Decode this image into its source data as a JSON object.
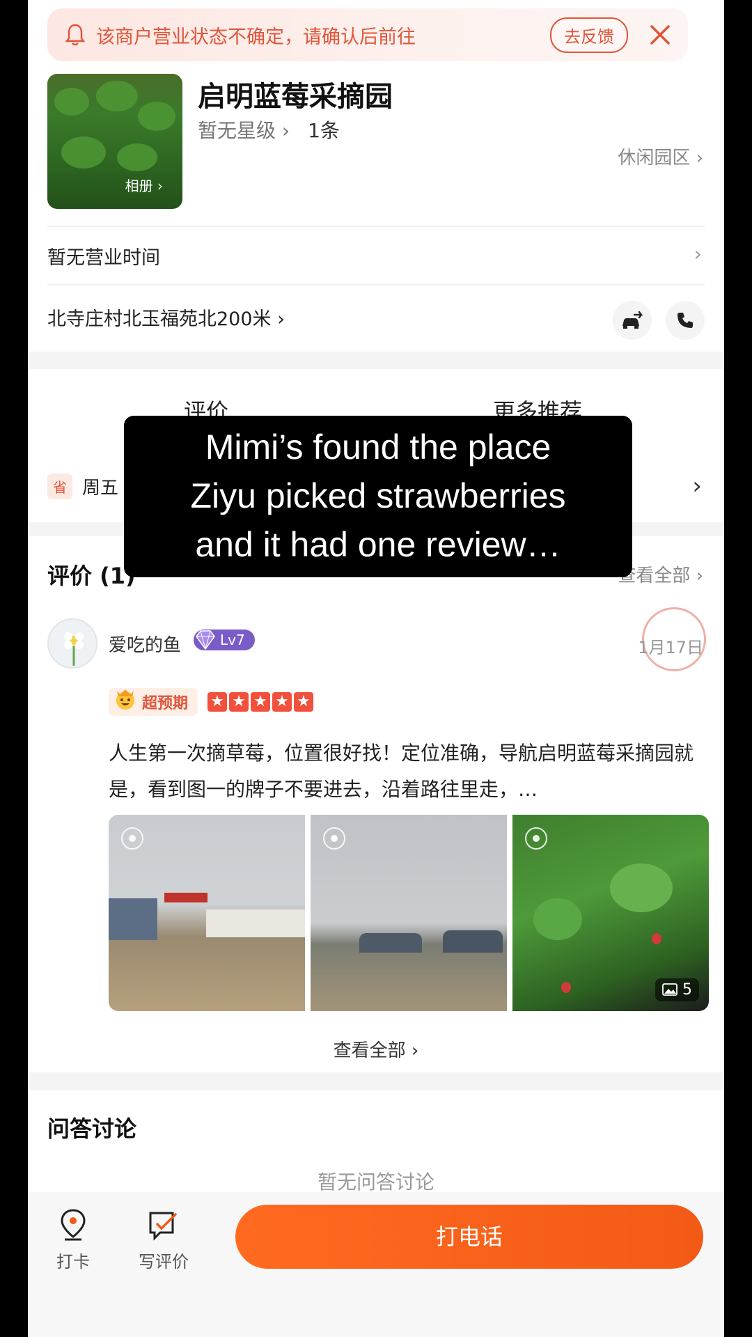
{
  "notice": {
    "text": "该商户营业状态不确定，请确认后前往",
    "feedback_label": "去反馈",
    "accent_color": "#e0553a"
  },
  "merchant": {
    "name": "启明蓝莓采摘园",
    "star_level": "暂无星级",
    "review_count": "1条",
    "category": "休闲园区",
    "album_label": "相册",
    "hours": "暂无营业时间",
    "address": "北寺庄村北玉福苑北200米"
  },
  "tabs": {
    "reviews": "评价",
    "more": "更多推荐"
  },
  "promo": {
    "badge": "省",
    "text": "周五"
  },
  "reviews": {
    "title": "评价 (1)",
    "see_all_top": "查看全部",
    "see_all_bottom": "查看全部",
    "item": {
      "username": "爱吃的鱼",
      "level": "Lv7",
      "date": "1月17日",
      "expectation": "超预期",
      "stars": 5,
      "text": "人生第一次摘草莓，位置很好找！定位准确，导航启明蓝莓采摘园就是，看到图一的牌子不要进去，沿着路往里走，…",
      "photo_count": "5"
    }
  },
  "qa": {
    "title": "问答讨论",
    "empty": "暂无问答讨论"
  },
  "bottom_bar": {
    "checkin": "打卡",
    "write_review": "写评价",
    "call": "打电话",
    "call_color": "#f35a16"
  },
  "caption": {
    "line1": "Mimi’s found the place",
    "line2": "Ziyu picked strawberries",
    "line3": "and it had one review…"
  }
}
